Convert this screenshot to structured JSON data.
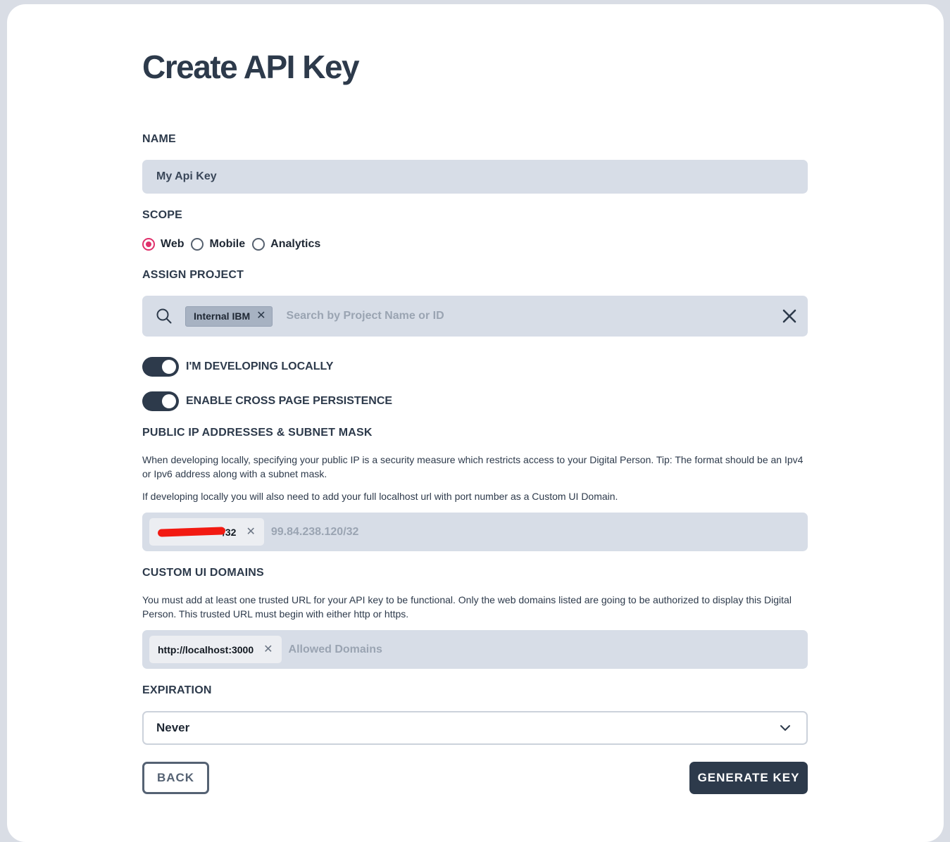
{
  "page": {
    "title": "Create API Key"
  },
  "name_field": {
    "label": "NAME",
    "value": "My Api Key"
  },
  "scope": {
    "label": "SCOPE",
    "options": [
      {
        "label": "Web",
        "selected": true
      },
      {
        "label": "Mobile",
        "selected": false
      },
      {
        "label": "Analytics",
        "selected": false
      }
    ]
  },
  "assign_project": {
    "label": "ASSIGN PROJECT",
    "chip": "Internal IBM",
    "placeholder": "Search by Project Name or ID"
  },
  "toggles": {
    "developing_locally": {
      "label": "I'M DEVELOPING LOCALLY",
      "on": true
    },
    "cross_page_persistence": {
      "label": "ENABLE CROSS PAGE PERSISTENCE",
      "on": true
    }
  },
  "public_ip": {
    "label": "PUBLIC IP ADDRESSES & SUBNET MASK",
    "help1": "When developing locally, specifying your public IP is a security measure which restricts access to your Digital Person. Tip: The format should be an Ipv4 or Ipv6 address along with a subnet mask.",
    "help2": "If developing locally you will also need to add your full localhost url with port number as a Custom UI Domain.",
    "chip_visible_suffix": "/32",
    "placeholder": "99.84.238.120/32"
  },
  "custom_ui_domains": {
    "label": "CUSTOM UI DOMAINS",
    "help": "You must add at least one trusted URL for your API key to be functional. Only the web domains listed are going to be authorized to display this Digital Person. This trusted URL must begin with either http or https.",
    "chip": "http://localhost:3000",
    "placeholder": "Allowed Domains"
  },
  "expiration": {
    "label": "EXPIRATION",
    "value": "Never"
  },
  "actions": {
    "back": "BACK",
    "generate": "GENERATE KEY"
  },
  "colors": {
    "primary": "#2d3a4b",
    "accent_radio": "#e0306b",
    "input_bg": "#d7dde7"
  }
}
